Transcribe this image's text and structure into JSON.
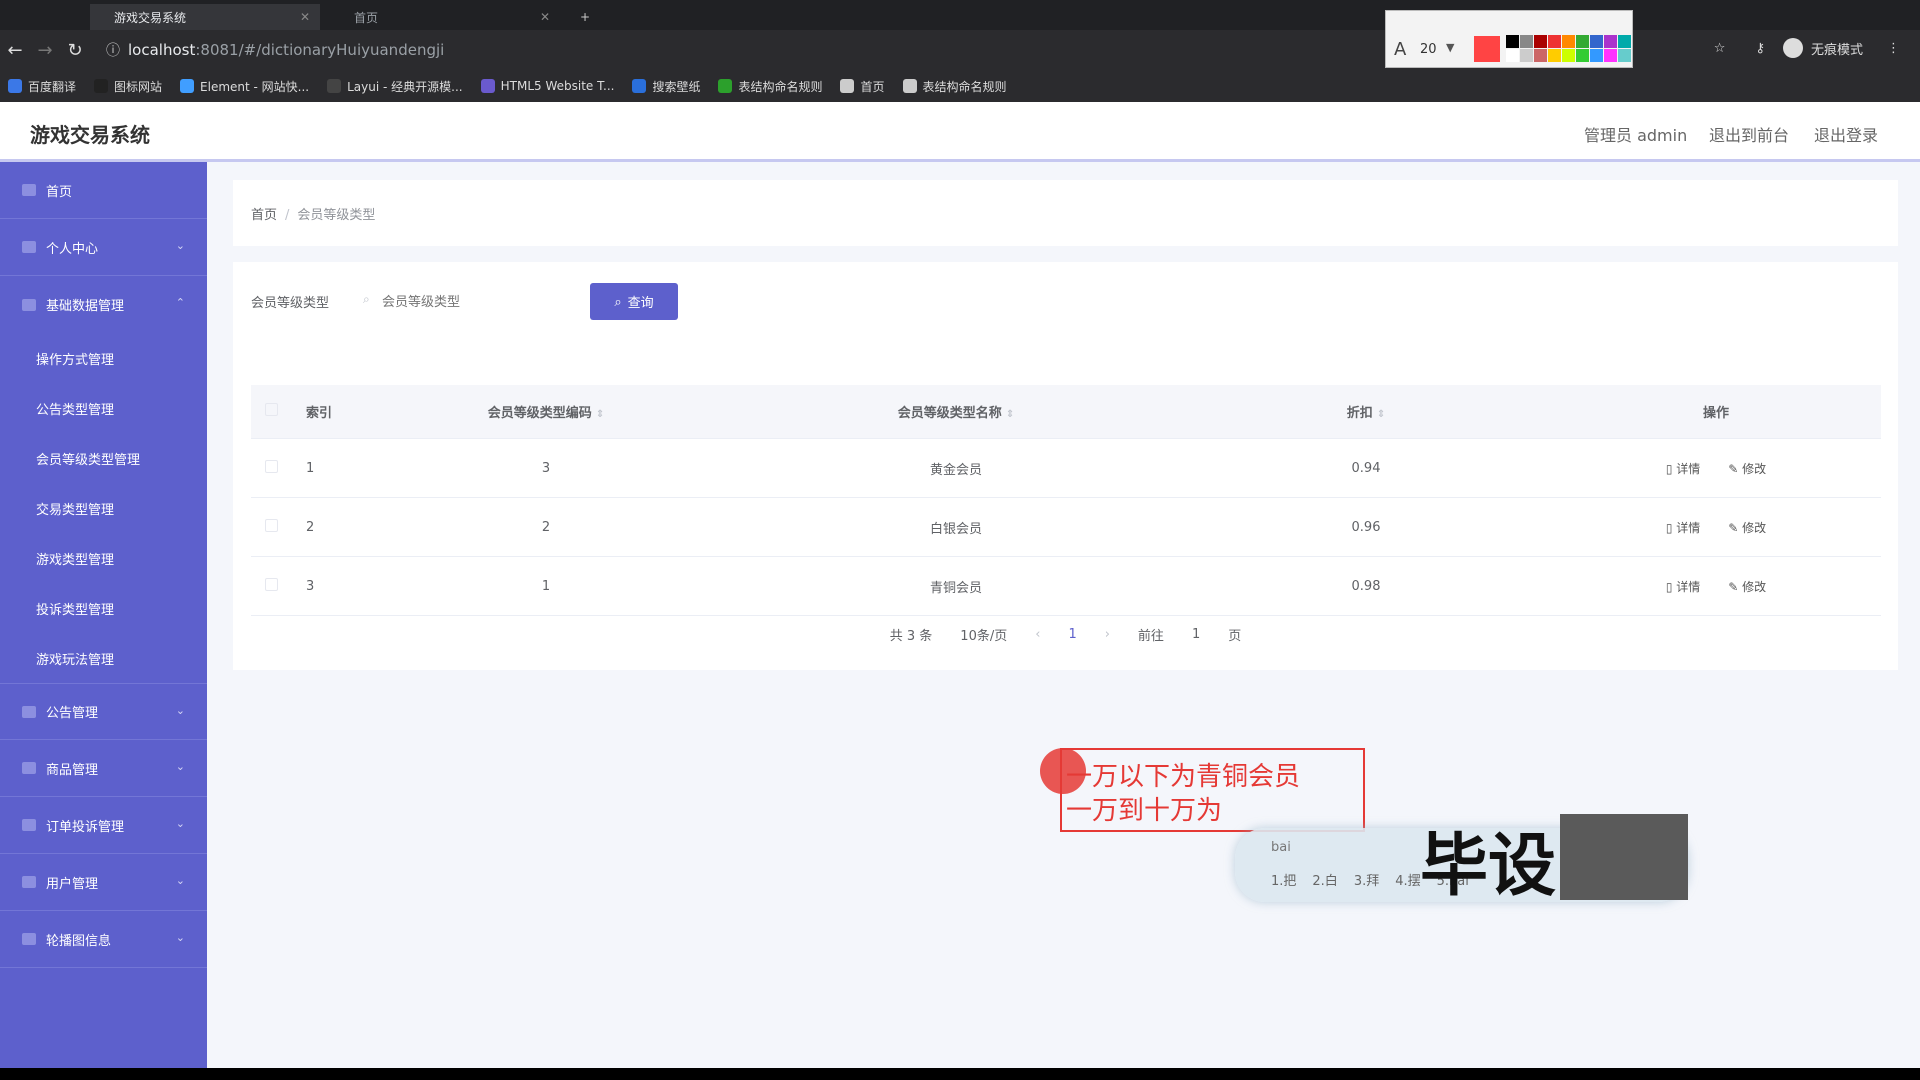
{
  "browser": {
    "tabs": [
      {
        "title": "游戏交易系统"
      },
      {
        "title": "首页"
      }
    ],
    "url_host": "localhost",
    "url_path": ":8081/#/dictionaryHuiyuandengji",
    "bookmarks": [
      {
        "label": "百度翻译",
        "color": "#3b78e7"
      },
      {
        "label": "图标网站",
        "color": "#222222"
      },
      {
        "label": "Element - 网站快...",
        "color": "#409eff"
      },
      {
        "label": "Layui - 经典开源模...",
        "color": "#444444"
      },
      {
        "label": "HTML5 Website T...",
        "color": "#6a5acd"
      },
      {
        "label": "搜索壁纸",
        "color": "#2a6fdb"
      },
      {
        "label": "表结构命名规则",
        "color": "#2ca02c"
      },
      {
        "label": "首页",
        "color": "#cccccc"
      },
      {
        "label": "表结构命名规则",
        "color": "#cccccc"
      }
    ],
    "annotation_tool_font_size": "20",
    "profile_label": "无痕模式"
  },
  "header": {
    "title": "游戏交易系统",
    "admin": "管理员 admin",
    "back_front": "退出到前台",
    "logout": "退出登录"
  },
  "sidebar": {
    "items": [
      {
        "label": "首页"
      },
      {
        "label": "个人中心"
      },
      {
        "label": "基础数据管理"
      }
    ],
    "submenu": [
      {
        "label": "操作方式管理"
      },
      {
        "label": "公告类型管理"
      },
      {
        "label": "会员等级类型管理"
      },
      {
        "label": "交易类型管理"
      },
      {
        "label": "游戏类型管理"
      },
      {
        "label": "投诉类型管理"
      },
      {
        "label": "游戏玩法管理"
      }
    ],
    "items_after": [
      {
        "label": "公告管理"
      },
      {
        "label": "商品管理"
      },
      {
        "label": "订单投诉管理"
      },
      {
        "label": "用户管理"
      },
      {
        "label": "轮播图信息"
      }
    ]
  },
  "breadcrumb": {
    "home": "首页",
    "current": "会员等级类型"
  },
  "search": {
    "label": "会员等级类型",
    "placeholder": "会员等级类型",
    "button": "查询"
  },
  "table": {
    "headers": [
      "索引",
      "会员等级类型编码",
      "会员等级类型名称",
      "折扣",
      "操作"
    ],
    "rows": [
      {
        "index": "1",
        "code": "3",
        "name": "黄金会员",
        "discount": "0.94"
      },
      {
        "index": "2",
        "code": "2",
        "name": "白银会员",
        "discount": "0.96"
      },
      {
        "index": "3",
        "code": "1",
        "name": "青铜会员",
        "discount": "0.98"
      }
    ],
    "detail_label": "详情",
    "edit_label": "修改"
  },
  "pagination": {
    "total": "共 3 条",
    "page_size": "10条/页",
    "current": "1",
    "goto": "前往",
    "goto_value": "1",
    "page_suffix": "页"
  },
  "annotation": {
    "line1": "一万以下为青铜会员",
    "line2": "一万到十万为"
  },
  "ime": {
    "pinyin": "bai",
    "candidates": [
      "1.把",
      "2.白",
      "3.拜",
      "4.摆",
      "5.bai"
    ]
  },
  "watermark": "毕设"
}
